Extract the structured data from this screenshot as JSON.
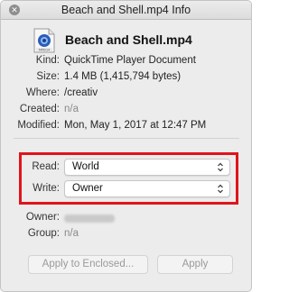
{
  "window": {
    "title": "Beach and Shell.mp4 Info"
  },
  "header": {
    "file_name": "Beach and Shell.mp4",
    "icon": "quicktime-movie-icon"
  },
  "info": [
    {
      "label": "Kind:",
      "value": "QuickTime Player Document"
    },
    {
      "label": "Size:",
      "value": "1.4 MB (1,415,794 bytes)"
    },
    {
      "label": "Where:",
      "value": "/creativ"
    },
    {
      "label": "Created:",
      "value": "n/a"
    },
    {
      "label": "Modified:",
      "value": "Mon, May 1, 2017 at 12:47 PM"
    }
  ],
  "permissions": {
    "read": {
      "label": "Read:",
      "value": "World"
    },
    "write": {
      "label": "Write:",
      "value": "Owner"
    }
  },
  "ownership": {
    "owner_label": "Owner:",
    "group_label": "Group:",
    "group_value": "n/a"
  },
  "buttons": {
    "apply_enclosed": "Apply to Enclosed...",
    "apply": "Apply"
  },
  "colors": {
    "highlight": "#e0141b",
    "window_bg": "#ececec",
    "disabled_text": "#9a9a9a"
  }
}
